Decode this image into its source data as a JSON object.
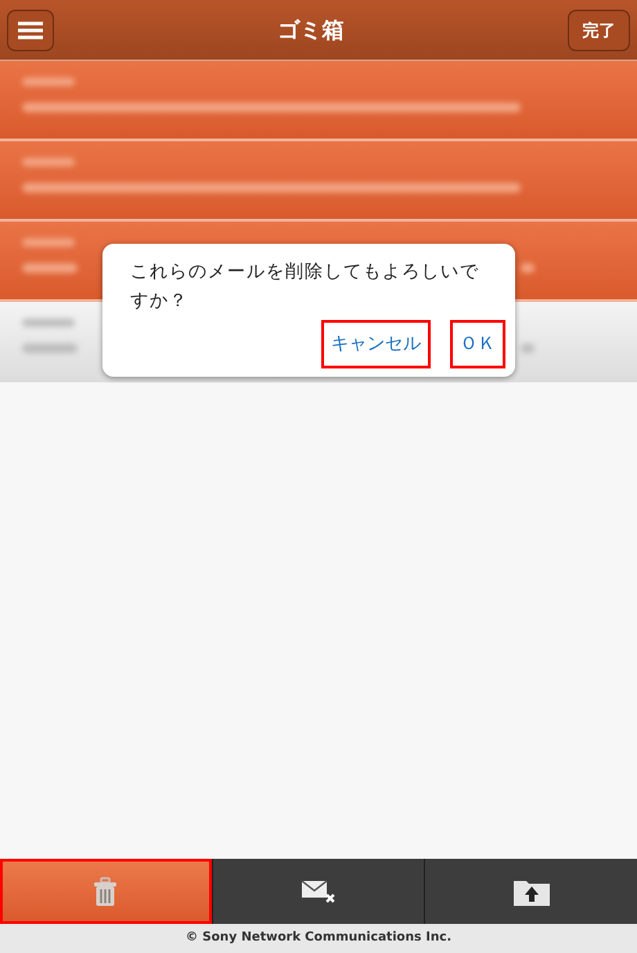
{
  "header": {
    "title": "ゴミ箱",
    "done_button": "完了"
  },
  "mails": [
    {
      "selected": true
    },
    {
      "selected": true
    },
    {
      "selected": true
    },
    {
      "selected": false
    }
  ],
  "dialog": {
    "message": "これらのメールを削除してもよろしいですか？",
    "buttons": [
      {
        "label": "キャンセル",
        "highlighted": true
      },
      {
        "label": "ＯＫ",
        "highlighted": true
      }
    ]
  },
  "toolbar": [
    {
      "kind": "trash",
      "selected": true,
      "highlighted": true
    },
    {
      "kind": "unread",
      "selected": false,
      "highlighted": false
    },
    {
      "kind": "move",
      "selected": false,
      "highlighted": false
    }
  ],
  "footer": "© Sony Network Communications Inc."
}
